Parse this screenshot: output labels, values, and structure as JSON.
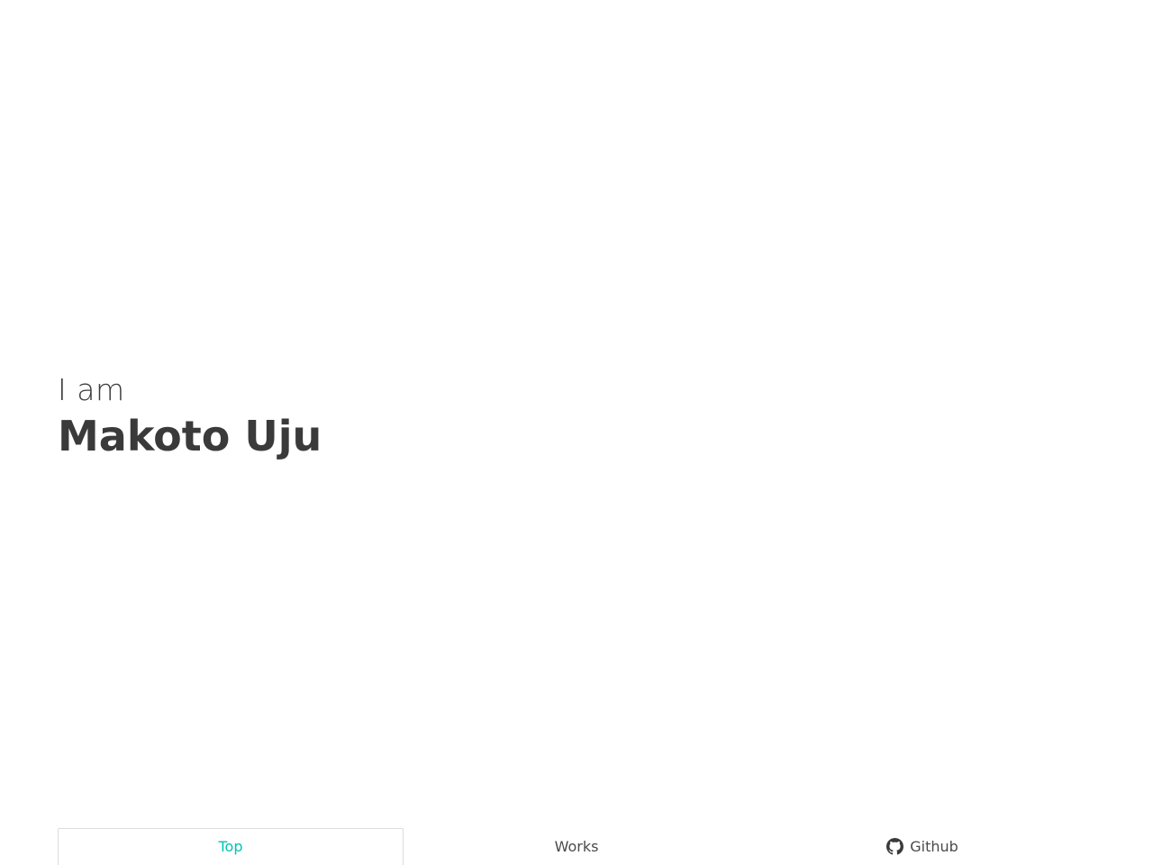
{
  "hero": {
    "intro": "I am",
    "name": "Makoto Uju"
  },
  "nav": {
    "tabs": [
      {
        "label": "Top",
        "active": true
      },
      {
        "label": "Works",
        "active": false
      },
      {
        "label": "Github",
        "active": false,
        "icon": "github-icon"
      }
    ]
  },
  "colors": {
    "accent": "#00c4b4",
    "text": "#3a3a3a",
    "border": "#dcdcdc",
    "background": "#ffffff"
  }
}
